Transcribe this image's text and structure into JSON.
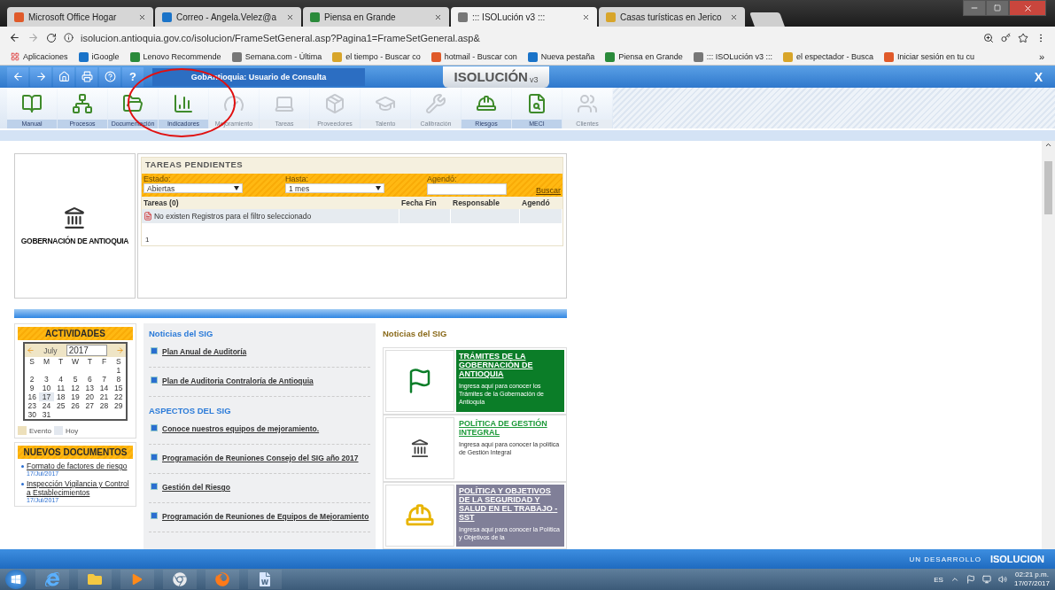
{
  "browser": {
    "tabs": [
      {
        "title": "Microsoft Office Hogar",
        "selected": false
      },
      {
        "title": "Correo - Angela.Velez@a",
        "selected": false
      },
      {
        "title": "Piensa en Grande",
        "selected": false
      },
      {
        "title": "::: ISOLución v3 :::",
        "selected": true
      },
      {
        "title": "Casas turísticas en Jerico",
        "selected": false
      }
    ],
    "url": "isolucion.antioquia.gov.co/isolucion/FrameSetGeneral.asp?Pagina1=FrameSetGeneral.asp&",
    "bookmarks": [
      "Aplicaciones",
      "iGoogle",
      "Lenovo Recommende",
      "Semana.com - Última",
      "el tiempo - Buscar co",
      "hotmail - Buscar con",
      "Nueva pestaña",
      "Piensa en Grande",
      "::: ISOLución v3 :::",
      "el espectador - Busca",
      "Iniciar sesión en tu cu"
    ],
    "bookmarks_more": "»"
  },
  "app": {
    "help_label": "?",
    "user_title": "GobAntioquia: Usuario de Consulta",
    "logo": "ISOLUCIÓN",
    "logo_version": "v3",
    "close_label": "X",
    "modules": [
      {
        "label": "Manual",
        "disabled": false
      },
      {
        "label": "Procesos",
        "disabled": false
      },
      {
        "label": "Documentación",
        "disabled": false
      },
      {
        "label": "Indicadores",
        "disabled": false
      },
      {
        "label": "Mejoramiento",
        "disabled": true
      },
      {
        "label": "Tareas",
        "disabled": true
      },
      {
        "label": "Proveedores",
        "disabled": true
      },
      {
        "label": "Talento",
        "disabled": true
      },
      {
        "label": "Calibración",
        "disabled": true
      },
      {
        "label": "Riesgos",
        "disabled": false
      },
      {
        "label": "MECI",
        "disabled": false
      },
      {
        "label": "Clientes",
        "disabled": true
      }
    ]
  },
  "org": {
    "name": "GOBERNACIÓN DE ANTIOQUIA"
  },
  "tasks": {
    "title": "TAREAS PENDIENTES",
    "filters": [
      {
        "label": "Estado:",
        "kind": "select",
        "value": "Abiertas"
      },
      {
        "label": "Hasta:",
        "kind": "select",
        "value": "1 mes"
      },
      {
        "label": "Agendó:",
        "kind": "text"
      }
    ],
    "search_link": "Buscar",
    "columns": [
      "Tareas (0)",
      "Fecha Fin",
      "Responsable",
      "Agendó"
    ],
    "empty_message": "No existen Registros para el filtro seleccionado",
    "page": "1"
  },
  "activities": {
    "title": "ACTIVIDADES",
    "month": "July",
    "year": "2017",
    "weekdays": [
      "S",
      "M",
      "T",
      "W",
      "T",
      "F",
      "S"
    ],
    "weeks": [
      [
        {
          "day": "1",
          "today": false
        }
      ],
      [
        {
          "day": "2",
          "today": false
        },
        {
          "day": "3",
          "today": false
        },
        {
          "day": "4",
          "today": false
        },
        {
          "day": "5",
          "today": false
        },
        {
          "day": "6",
          "today": false
        },
        {
          "day": "7",
          "today": false
        },
        {
          "day": "8",
          "today": false
        }
      ],
      [
        {
          "day": "9",
          "today": false
        },
        {
          "day": "10",
          "today": false
        },
        {
          "day": "11",
          "today": false
        },
        {
          "day": "12",
          "today": false
        },
        {
          "day": "13",
          "today": false
        },
        {
          "day": "14",
          "today": false
        },
        {
          "day": "15",
          "today": false
        }
      ],
      [
        {
          "day": "16",
          "today": false
        },
        {
          "day": "17",
          "today": true
        },
        {
          "day": "18",
          "today": false
        },
        {
          "day": "19",
          "today": false
        },
        {
          "day": "20",
          "today": false
        },
        {
          "day": "21",
          "today": false
        },
        {
          "day": "22",
          "today": false
        }
      ],
      [
        {
          "day": "23",
          "today": false
        },
        {
          "day": "24",
          "today": false
        },
        {
          "day": "25",
          "today": false
        },
        {
          "day": "26",
          "today": false
        },
        {
          "day": "27",
          "today": false
        },
        {
          "day": "28",
          "today": false
        },
        {
          "day": "29",
          "today": false
        }
      ],
      [
        {
          "day": "30",
          "today": false
        },
        {
          "day": "31",
          "today": false
        }
      ]
    ],
    "legend": [
      {
        "label": "Evento",
        "color": "#ede0bb"
      },
      {
        "label": "Hoy",
        "color": "#e3e8ef"
      }
    ]
  },
  "new_documents": {
    "title": "NUEVOS DOCUMENTOS",
    "items": [
      {
        "title": "Formato de factores de riesgo",
        "date": "17/Jul/2017"
      },
      {
        "title": "Inspección Vigilancia y Control a Establecimientos",
        "date": "17/Jul/2017"
      }
    ]
  },
  "news": {
    "title": "Noticias del SIG",
    "items": [
      "Plan Anual de Auditoría",
      "Plan de Auditoria Contraloría de Antioquia"
    ],
    "section": "ASPECTOS DEL SIG",
    "section_items": [
      "Conoce nuestros equipos de mejoramiento.",
      "Programación de Reuniones Consejo del SIG año 2017",
      "Gestión del Riesgo",
      "Programación de Reuniones de Equipos de Mejoramiento"
    ]
  },
  "featured": {
    "title": "Noticias del SIG",
    "cards": [
      {
        "kind": "flag",
        "filled": true,
        "color": "#0b7d28",
        "title": "TRÁMITES DE LA GOBERNACIÓN DE ANTIOQUIA",
        "text": "Ingresa aquí para conocer los Trámites de la Gobernación de Antioquia"
      },
      {
        "kind": "seal",
        "filled": false,
        "color": "#ffffff",
        "title": "POLÍTICA DE GESTIÓN INTEGRAL",
        "text": "Ingresa aquí para conocer la política de Gestión Integral"
      },
      {
        "kind": "worker",
        "filled": true,
        "color": "#807f98",
        "title": "POLÍTICA Y OBJETIVOS DE LA SEGURIDAD Y SALUD EN EL TRABAJO - SST",
        "text": "Ingresa aquí para conocer la Política y Objetivos de la"
      }
    ]
  },
  "footer": {
    "credit": "UN DESARROLLO",
    "logo": "ISOLUCION"
  },
  "taskbar": {
    "language": "ES",
    "time": "02:21 p.m.",
    "date": "17/07/2017"
  }
}
